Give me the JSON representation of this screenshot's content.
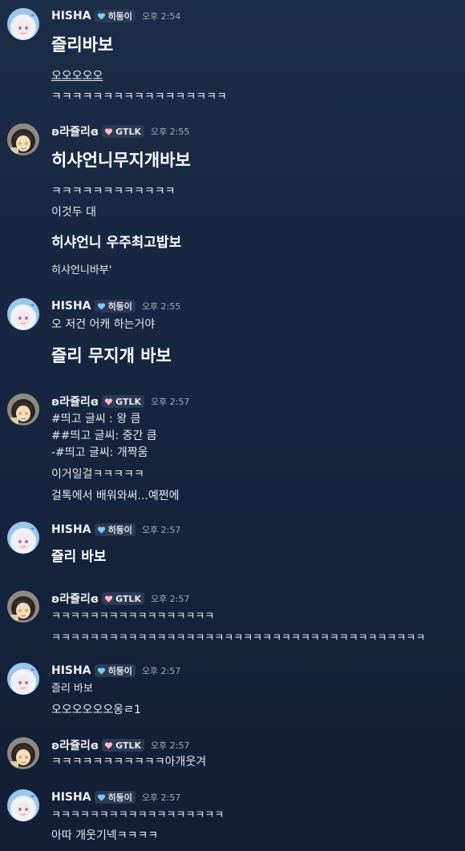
{
  "users": {
    "hisha": {
      "name": "HISHA",
      "tag": "히둥이",
      "heart_color": "#7ec8ff"
    },
    "jully": {
      "name": "ʚ라쥴리ɞ",
      "tag": "GTLK",
      "heart_color": "#f6b7c6"
    }
  },
  "messages": [
    {
      "time": "오후 2:54",
      "lines": [
        "즐리바보",
        "오오오오오",
        "ㅋㅋㅋㅋㅋㅋㅋㅋㅋㅋㅋㅋㅋㅋㅋㅋㅋ"
      ]
    },
    {
      "time": "오후 2:55",
      "lines": [
        "히샤언니무지개바보",
        "ㅋㅋㅋㅋㅋㅋㅋㅋㅋㅋㅋㅋ",
        "이것두 대",
        "히샤언니 우주최고밥보",
        "히샤언니바부'"
      ]
    },
    {
      "time": "오후 2:55",
      "lines": [
        "오 저건 어캐 하는거야",
        "즐리 무지개 바보"
      ]
    },
    {
      "time": "오후 2:57",
      "lines": [
        "#띄고 글씨 : 왕 큼",
        "##띄고 글씨: 중간 큼",
        "-#띄고 글씨: 개짝움",
        "이거일걸ㅋㅋㅋㅋㅋ",
        "걸톡에서 배워와써...예쩐에"
      ]
    },
    {
      "time": "오후 2:57",
      "lines": [
        "즐리 바보"
      ]
    },
    {
      "time": "오후 2:57",
      "lines": [
        "ㅋㅋㅋㅋㅋㅋㅋㅋㅋㅋㅋㅋㅋㅋㅋㅋㅋ",
        "ㅋㅋㅋㅋㅋㅋㅋㅋㅋㅋㅋㅋㅋㅋㅋㅋㅋㅋㅋㅋㅋㅋㅋㅋㅋㅋㅋㅋㅋㅋㅋㅋㅋㅋㅋㅋㅋㅋㅋ"
      ]
    },
    {
      "time": "오후 2:57",
      "lines": [
        "즐리 바보",
        "오오오오오오옹ㄹ1"
      ]
    },
    {
      "time": "오후 2:57",
      "lines": [
        "ㅋㅋㅋㅋㅋㅋㅋㅋㅋㅋㅋ아개웃겨"
      ]
    },
    {
      "time": "오후 2:57",
      "lines": [
        "ㅋㅋㅋㅋㅋㅋㅋㅋㅋㅋㅋㅋㅋㅋㅋㅋㅋㅋ",
        "아따 개웃기넥ㅋㅋㅋㅋ"
      ]
    }
  ],
  "avatar_icons": {
    "hisha": "white-hair-anime-girl-avatar",
    "jully": "dark-hair-anime-girl-avatar"
  }
}
